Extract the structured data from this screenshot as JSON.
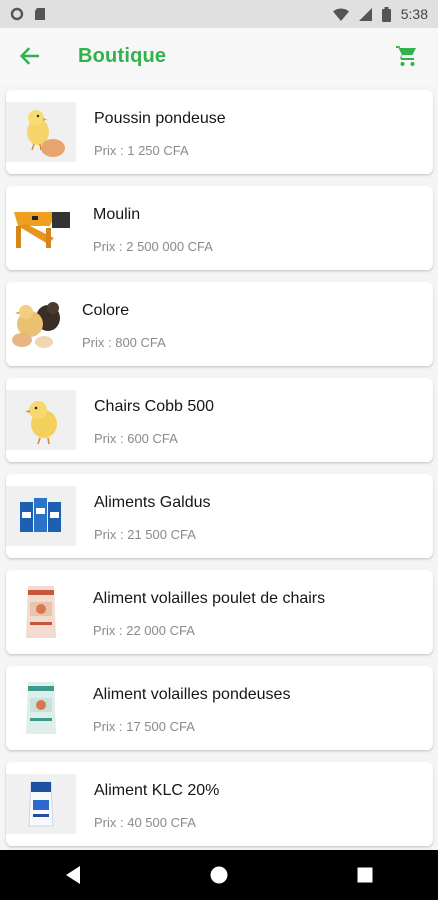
{
  "status_bar": {
    "time": "5:38"
  },
  "app_bar": {
    "title": "Boutique"
  },
  "colors": {
    "accent": "#2fb34a",
    "status_bar_bg": "#e0e0e0",
    "nav_bar_bg": "#000000"
  },
  "products": [
    {
      "name": "Poussin pondeuse",
      "price": "Prix : 1 250 CFA",
      "image": "chick-with-egg"
    },
    {
      "name": "Moulin",
      "price": "Prix : 2 500 000 CFA",
      "image": "orange-mill-machine"
    },
    {
      "name": "Colore",
      "price": "Prix : 800 CFA",
      "image": "colored-chicks"
    },
    {
      "name": "Chairs Cobb 500",
      "price": "Prix : 600 CFA",
      "image": "chick"
    },
    {
      "name": "Aliments Galdus",
      "price": "Prix : 21 500 CFA",
      "image": "blue-feed-bags"
    },
    {
      "name": "Aliment volailles poulet de chairs",
      "price": "Prix : 22 000 CFA",
      "image": "feed-sack-broiler"
    },
    {
      "name": "Aliment volailles pondeuses",
      "price": "Prix : 17 500 CFA",
      "image": "feed-sack-layer"
    },
    {
      "name": "Aliment KLC 20%",
      "price": "Prix : 40 500 CFA",
      "image": "feed-bag-klc"
    }
  ]
}
